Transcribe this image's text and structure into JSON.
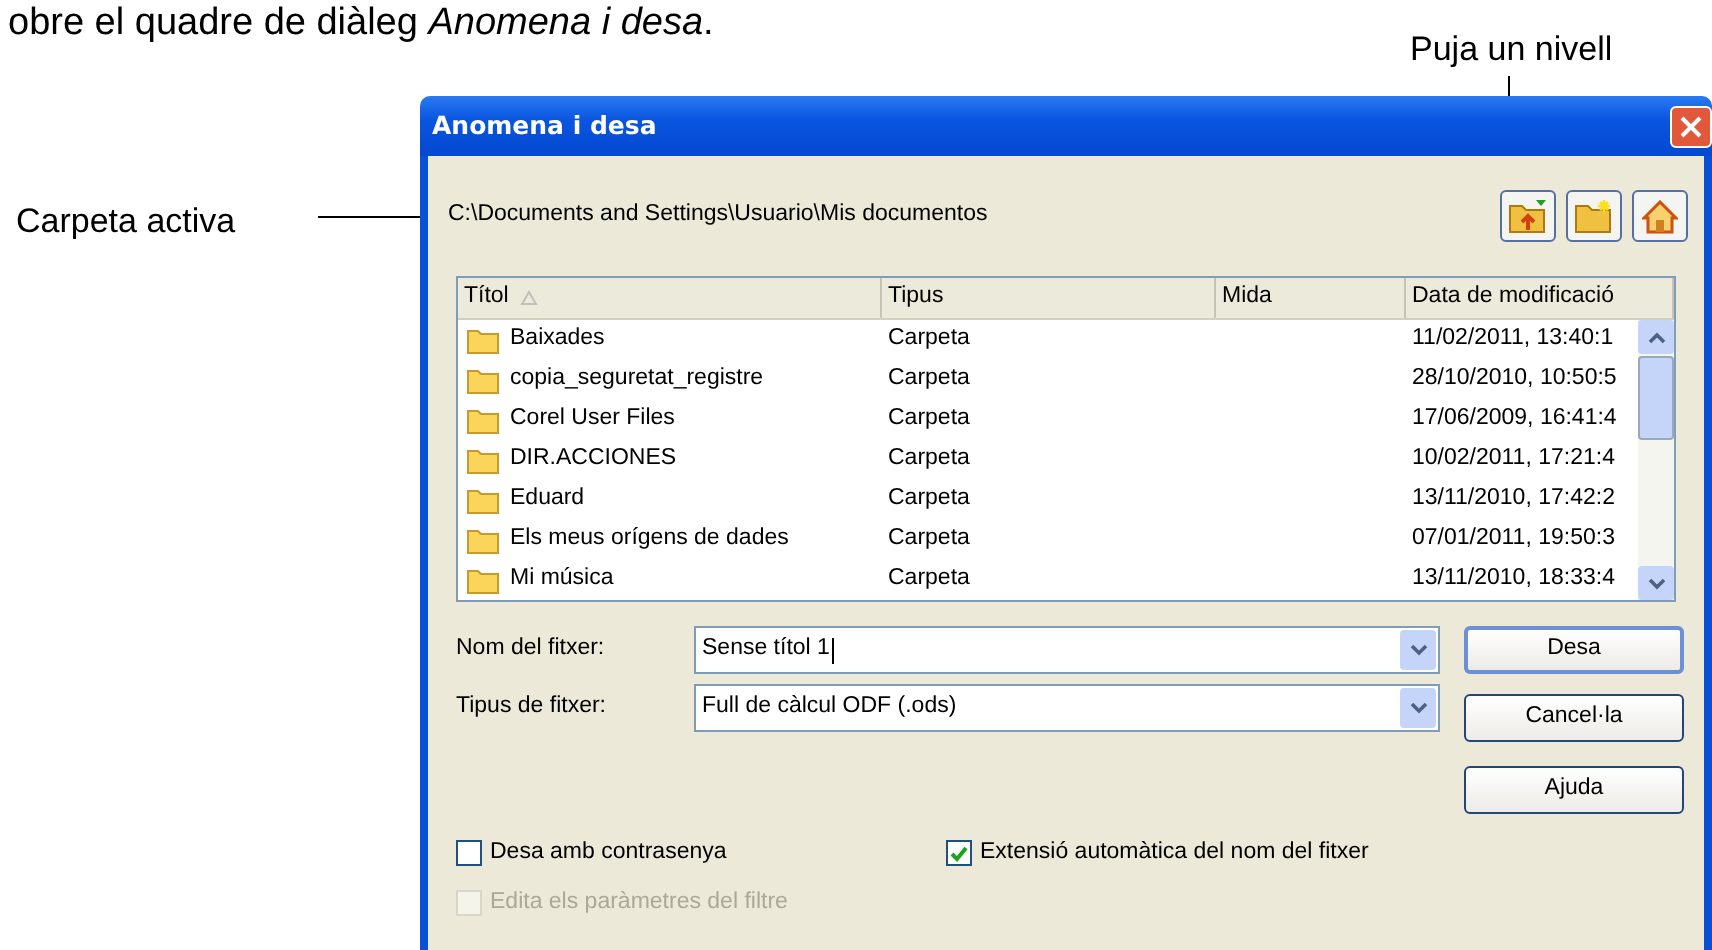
{
  "heading": "obre el quadre de diàleg *Anomena i desa*.",
  "callout_top": "Puja un nivell",
  "callout_left": "Carpeta activa",
  "dialog": {
    "title": "Anomena i desa",
    "path": "C:\\Documents and Settings\\Usuario\\Mis documentos",
    "file_list": {
      "columns": [
        {
          "label": "Títol",
          "sorted": true
        },
        {
          "label": "Tipus",
          "sorted": false
        },
        {
          "label": "Mida",
          "sorted": false
        },
        {
          "label": "Data de modificació",
          "sorted": false
        }
      ],
      "rows": [
        {
          "name": "Baixades",
          "type": "Carpeta",
          "modified": "11/02/2011, 13:40:1"
        },
        {
          "name": "copia_seguretat_registre",
          "type": "Carpeta",
          "modified": "28/10/2010, 10:50:5"
        },
        {
          "name": "Corel User Files",
          "type": "Carpeta",
          "modified": "17/06/2009, 16:41:4"
        },
        {
          "name": "DIR.ACCIONES",
          "type": "Carpeta",
          "modified": "10/02/2011, 17:21:4"
        },
        {
          "name": "Eduard",
          "type": "Carpeta",
          "modified": "13/11/2010, 17:42:2"
        },
        {
          "name": "Els meus orígens de dades",
          "type": "Carpeta",
          "modified": "07/01/2011, 19:50:3"
        },
        {
          "name": "Mi música",
          "type": "Carpeta",
          "modified": "13/11/2010, 18:33:4"
        }
      ]
    },
    "fields": [
      {
        "label": "Nom del fitxer:",
        "value": "Sense títol 1",
        "kind": "combo"
      },
      {
        "label": "Tipus de fitxer:",
        "value": "Full de càlcul ODF (.ods)",
        "kind": "dropdown"
      }
    ],
    "buttons": [
      {
        "label": "Desa",
        "default": true
      },
      {
        "label": "Cancel·la",
        "default": false
      },
      {
        "label": "Ajuda",
        "default": false
      }
    ],
    "options": [
      {
        "label": "Desa amb contrasenya",
        "checked": false,
        "disabled": false
      },
      {
        "label": "Extensió automàtica del nom del fitxer",
        "checked": true,
        "disabled": false
      },
      {
        "label": "Edita els paràmetres del filtre",
        "checked": false,
        "disabled": true
      }
    ]
  }
}
